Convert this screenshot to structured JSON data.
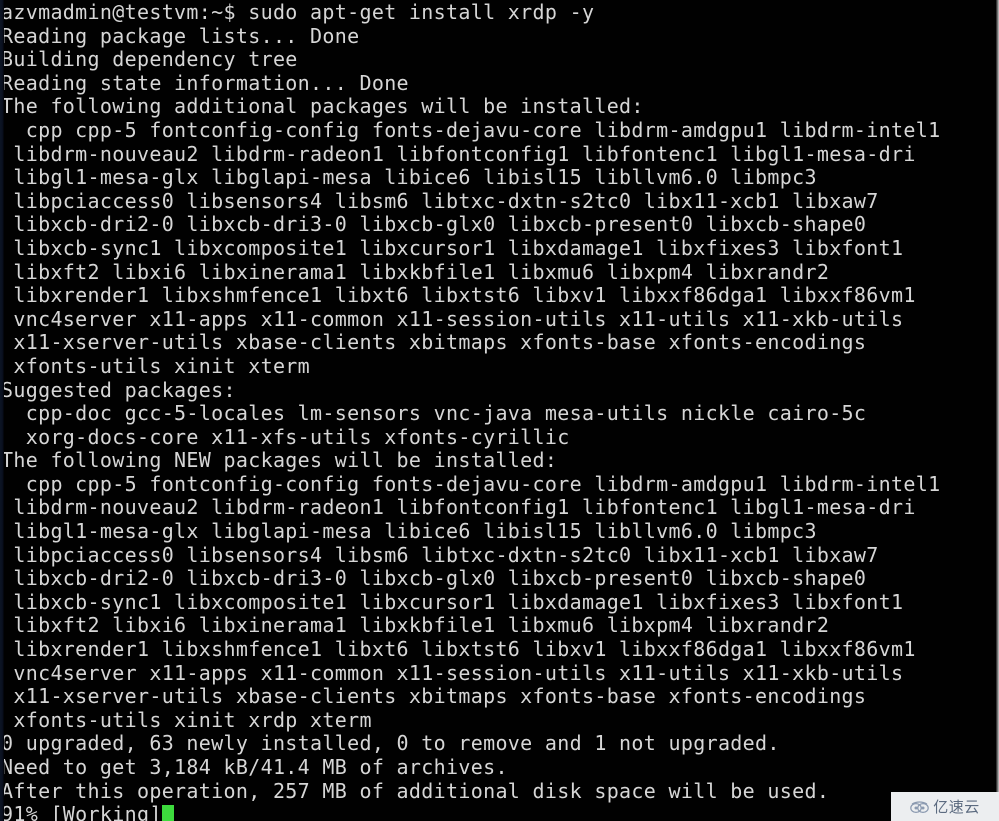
{
  "terminal": {
    "prompt": "azvmadmin@testvm:~$ ",
    "command": "sudo apt-get install xrdp -y",
    "colors": {
      "background": "#010101",
      "foreground": "#d6d6d6",
      "cursor": "#3ddb3d",
      "left_edge": "#0d1524"
    },
    "cursor": {
      "name": "block-cursor",
      "visible": true
    },
    "lines": [
      "azvmadmin@testvm:~$ sudo apt-get install xrdp -y",
      "Reading package lists... Done",
      "Building dependency tree",
      "Reading state information... Done",
      "The following additional packages will be installed:",
      "  cpp cpp-5 fontconfig-config fonts-dejavu-core libdrm-amdgpu1 libdrm-intel1",
      " libdrm-nouveau2 libdrm-radeon1 libfontconfig1 libfontenc1 libgl1-mesa-dri",
      " libgl1-mesa-glx libglapi-mesa libice6 libisl15 libllvm6.0 libmpc3",
      " libpciaccess0 libsensors4 libsm6 libtxc-dxtn-s2tc0 libx11-xcb1 libxaw7",
      " libxcb-dri2-0 libxcb-dri3-0 libxcb-glx0 libxcb-present0 libxcb-shape0",
      " libxcb-sync1 libxcomposite1 libxcursor1 libxdamage1 libxfixes3 libxfont1",
      " libxft2 libxi6 libxinerama1 libxkbfile1 libxmu6 libxpm4 libxrandr2",
      " libxrender1 libxshmfence1 libxt6 libxtst6 libxv1 libxxf86dga1 libxxf86vm1",
      " vnc4server x11-apps x11-common x11-session-utils x11-utils x11-xkb-utils",
      " x11-xserver-utils xbase-clients xbitmaps xfonts-base xfonts-encodings",
      " xfonts-utils xinit xterm",
      "Suggested packages:",
      "  cpp-doc gcc-5-locales lm-sensors vnc-java mesa-utils nickle cairo-5c",
      "  xorg-docs-core x11-xfs-utils xfonts-cyrillic",
      "The following NEW packages will be installed:",
      "  cpp cpp-5 fontconfig-config fonts-dejavu-core libdrm-amdgpu1 libdrm-intel1",
      " libdrm-nouveau2 libdrm-radeon1 libfontconfig1 libfontenc1 libgl1-mesa-dri",
      " libgl1-mesa-glx libglapi-mesa libice6 libisl15 libllvm6.0 libmpc3",
      " libpciaccess0 libsensors4 libsm6 libtxc-dxtn-s2tc0 libx11-xcb1 libxaw7",
      " libxcb-dri2-0 libxcb-dri3-0 libxcb-glx0 libxcb-present0 libxcb-shape0",
      " libxcb-sync1 libxcomposite1 libxcursor1 libxdamage1 libxfixes3 libxfont1",
      " libxft2 libxi6 libxinerama1 libxkbfile1 libxmu6 libxpm4 libxrandr2",
      " libxrender1 libxshmfence1 libxt6 libxtst6 libxv1 libxxf86dga1 libxxf86vm1",
      " vnc4server x11-apps x11-common x11-session-utils x11-utils x11-xkb-utils",
      " x11-xserver-utils xbase-clients xbitmaps xfonts-base xfonts-encodings",
      " xfonts-utils xinit xrdp xterm",
      "0 upgraded, 63 newly installed, 0 to remove and 1 not upgraded.",
      "Need to get 3,184 kB/41.4 MB of archives.",
      "After this operation, 257 MB of additional disk space will be used."
    ],
    "progress_line": {
      "text": "91% [Working]",
      "percent": "91%",
      "status": "[Working]"
    }
  },
  "watermark": {
    "text": "亿速云",
    "icon": "cloud-icon",
    "background": "#eceef0",
    "foreground": "#5c6b80"
  }
}
